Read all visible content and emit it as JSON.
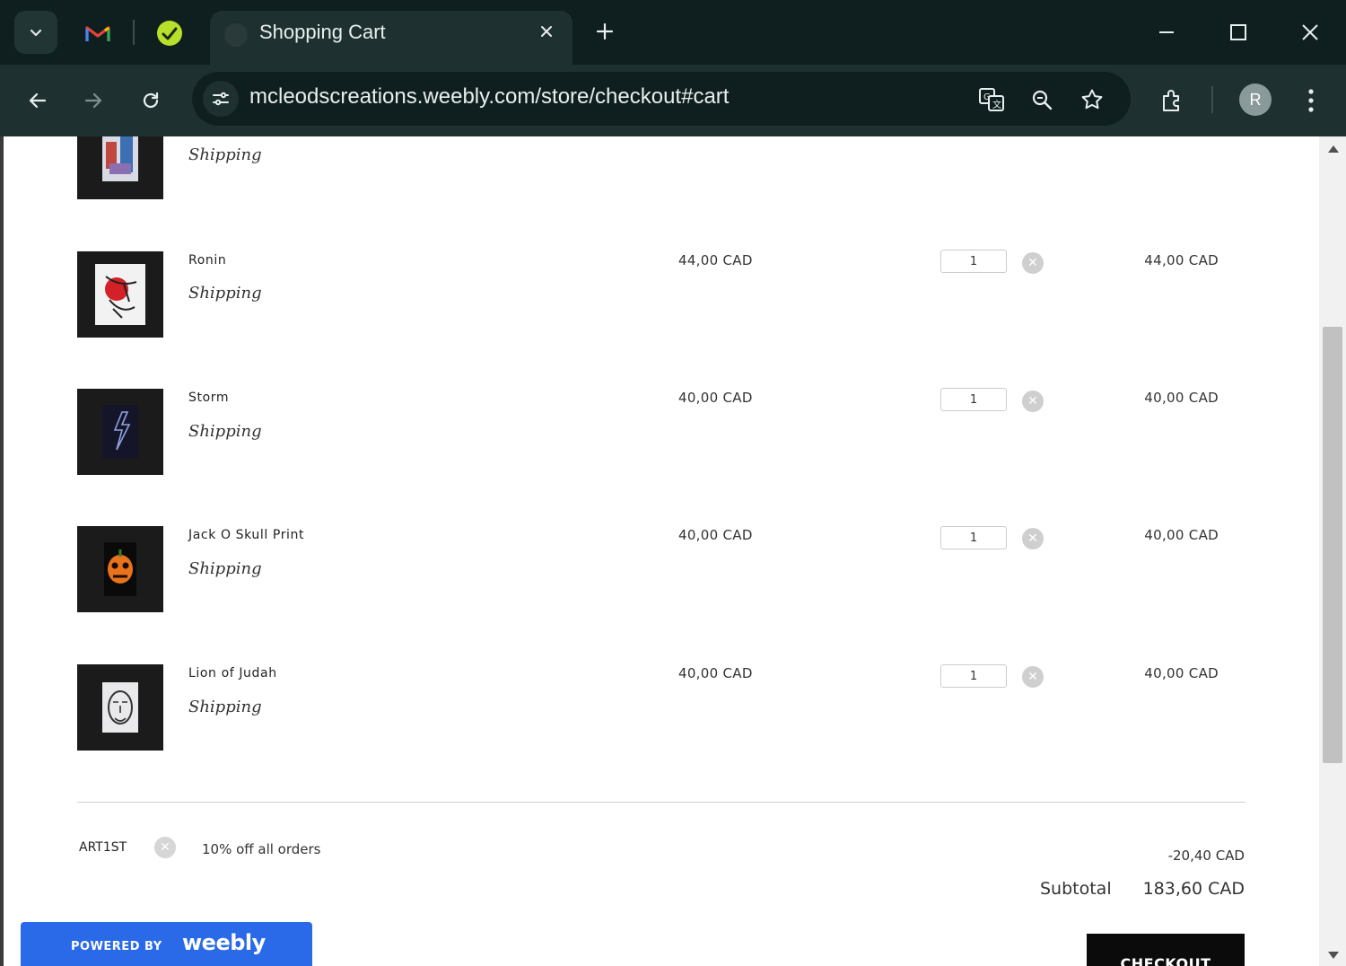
{
  "browser": {
    "tab_title": "Shopping Cart",
    "url": "mcleodscreations.weebly.com/store/checkout#cart",
    "profile_initial": "R"
  },
  "cart": {
    "first_item_partial": {
      "shipping_label": "Shipping"
    },
    "items": [
      {
        "name": "Ronin",
        "shipping_label": "Shipping",
        "price": "44,00 CAD",
        "quantity": "1",
        "total": "44,00 CAD"
      },
      {
        "name": "Storm",
        "shipping_label": "Shipping",
        "price": "40,00 CAD",
        "quantity": "1",
        "total": "40,00 CAD"
      },
      {
        "name": "Jack O Skull Print",
        "shipping_label": "Shipping",
        "price": "40,00 CAD",
        "quantity": "1",
        "total": "40,00 CAD"
      },
      {
        "name": "Lion of Judah",
        "shipping_label": "Shipping",
        "price": "40,00 CAD",
        "quantity": "1",
        "total": "40,00 CAD"
      }
    ],
    "coupon": {
      "code": "ART1ST",
      "description": "10% off all orders",
      "discount": "-20,40 CAD"
    },
    "subtotal_label": "Subtotal",
    "subtotal_value": "183,60 CAD",
    "checkout_label": "CHECKOUT"
  },
  "footer": {
    "powered_by": "POWERED BY",
    "brand": "weebly"
  },
  "colors": {
    "weebly_blue": "#2a6ae8",
    "checkout_black": "#0b0b0b",
    "chrome_dark": "#0f1f1f",
    "chrome_toolbar": "#1f3030"
  }
}
